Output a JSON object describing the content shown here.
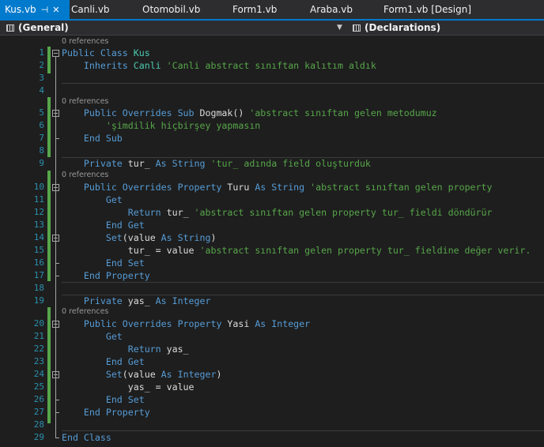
{
  "tabs": [
    {
      "label": "Kus.vb",
      "active": true
    },
    {
      "label": "Canli.vb"
    },
    {
      "label": "Otomobil.vb"
    },
    {
      "label": "Form1.vb"
    },
    {
      "label": "Araba.vb"
    },
    {
      "label": "Form1.vb [Design]"
    }
  ],
  "navbar": {
    "left": "(General)",
    "right": "(Declarations)"
  },
  "codelens": {
    "references": "0 references"
  },
  "lines": [
    {
      "n": "1",
      "parts": [
        [
          "k",
          "Public Class "
        ],
        [
          "t",
          "Kus"
        ]
      ]
    },
    {
      "n": "2",
      "parts": [
        [
          "",
          "    "
        ],
        [
          "k",
          "Inherits "
        ],
        [
          "t",
          "Canli"
        ],
        [
          "c",
          " 'Canli abstract sınıftan kalıtım aldık"
        ]
      ]
    },
    {
      "n": "3",
      "parts": []
    },
    {
      "n": "4",
      "parts": []
    },
    {
      "n": "5",
      "parts": [
        [
          "",
          "    "
        ],
        [
          "k",
          "Public Overrides Sub "
        ],
        [
          "",
          "Dogmak() "
        ],
        [
          "c",
          "'abstract sınıftan gelen metodumuz"
        ]
      ]
    },
    {
      "n": "6",
      "parts": [
        [
          "",
          "        "
        ],
        [
          "c",
          "'şimdilik hiçbirşey yapmasın"
        ]
      ]
    },
    {
      "n": "7",
      "parts": [
        [
          "",
          "    "
        ],
        [
          "k",
          "End Sub"
        ]
      ]
    },
    {
      "n": "8",
      "parts": []
    },
    {
      "n": "9",
      "parts": [
        [
          "",
          "    "
        ],
        [
          "k",
          "Private "
        ],
        [
          "",
          "tur_ "
        ],
        [
          "k",
          "As String "
        ],
        [
          "c",
          "'tur_ adında field oluşturduk"
        ]
      ]
    },
    {
      "n": "10",
      "parts": [
        [
          "",
          "    "
        ],
        [
          "k",
          "Public Overrides Property "
        ],
        [
          "",
          "Turu "
        ],
        [
          "k",
          "As String "
        ],
        [
          "c",
          "'abstract sınıftan gelen property"
        ]
      ]
    },
    {
      "n": "11",
      "parts": [
        [
          "",
          "        "
        ],
        [
          "k",
          "Get"
        ]
      ]
    },
    {
      "n": "12",
      "parts": [
        [
          "",
          "            "
        ],
        [
          "k",
          "Return "
        ],
        [
          "",
          "tur_ "
        ],
        [
          "c",
          "'abstract sınıftan gelen property tur_ fieldi döndürür"
        ]
      ]
    },
    {
      "n": "13",
      "parts": [
        [
          "",
          "        "
        ],
        [
          "k",
          "End Get"
        ]
      ]
    },
    {
      "n": "14",
      "parts": [
        [
          "",
          "        "
        ],
        [
          "k",
          "Set"
        ],
        [
          "",
          "(value "
        ],
        [
          "k",
          "As String"
        ],
        [
          "",
          ")"
        ]
      ]
    },
    {
      "n": "15",
      "parts": [
        [
          "",
          "            tur_ = value "
        ],
        [
          "c",
          "'abstract sınıftan gelen property tur_ fieldine değer verir."
        ]
      ]
    },
    {
      "n": "16",
      "parts": [
        [
          "",
          "        "
        ],
        [
          "k",
          "End Set"
        ]
      ]
    },
    {
      "n": "17",
      "parts": [
        [
          "",
          "    "
        ],
        [
          "k",
          "End Property"
        ]
      ]
    },
    {
      "n": "18",
      "parts": []
    },
    {
      "n": "19",
      "parts": [
        [
          "",
          "    "
        ],
        [
          "k",
          "Private "
        ],
        [
          "",
          "yas_ "
        ],
        [
          "k",
          "As Integer"
        ]
      ]
    },
    {
      "n": "20",
      "parts": [
        [
          "",
          "    "
        ],
        [
          "k",
          "Public Overrides Property "
        ],
        [
          "",
          "Yasi "
        ],
        [
          "k",
          "As Integer"
        ]
      ]
    },
    {
      "n": "21",
      "parts": [
        [
          "",
          "        "
        ],
        [
          "k",
          "Get"
        ]
      ]
    },
    {
      "n": "22",
      "parts": [
        [
          "",
          "            "
        ],
        [
          "k",
          "Return "
        ],
        [
          "",
          "yas_"
        ]
      ]
    },
    {
      "n": "23",
      "parts": [
        [
          "",
          "        "
        ],
        [
          "k",
          "End Get"
        ]
      ]
    },
    {
      "n": "24",
      "parts": [
        [
          "",
          "        "
        ],
        [
          "k",
          "Set"
        ],
        [
          "",
          "(value "
        ],
        [
          "k",
          "As Integer"
        ],
        [
          "",
          ")"
        ]
      ]
    },
    {
      "n": "25",
      "parts": [
        [
          "",
          "            yas_ = value"
        ]
      ]
    },
    {
      "n": "26",
      "parts": [
        [
          "",
          "        "
        ],
        [
          "k",
          "End Set"
        ]
      ]
    },
    {
      "n": "27",
      "parts": [
        [
          "",
          "    "
        ],
        [
          "k",
          "End Property"
        ]
      ]
    },
    {
      "n": "28",
      "parts": []
    },
    {
      "n": "29",
      "parts": [
        [
          "k",
          "End Class"
        ]
      ]
    }
  ],
  "colors": {
    "keyword": "#569cd6",
    "type": "#4ec9b0",
    "comment": "#57a64a",
    "line_number": "#2b91af",
    "accent": "#007acc",
    "change_marker": "#57a64a"
  },
  "icons": {
    "pin": "pin-icon",
    "close": "close-icon",
    "nav": "class-nav-icon",
    "dropdown": "chevron-down-icon",
    "fold": "collapse-icon"
  }
}
